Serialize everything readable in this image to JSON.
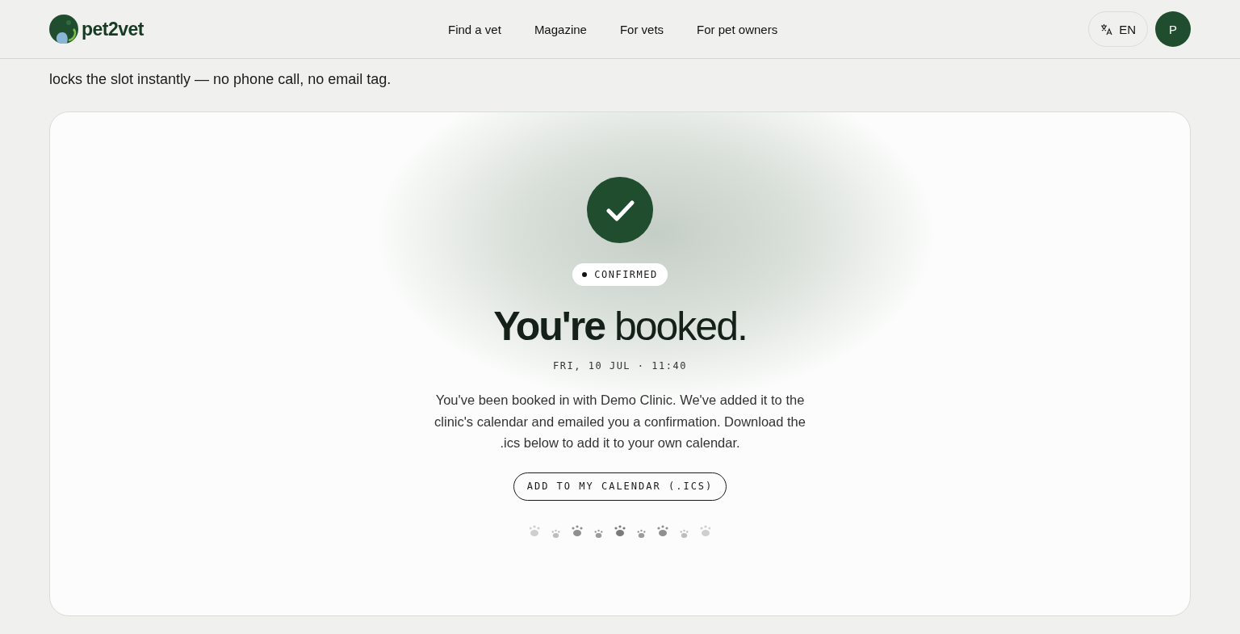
{
  "header": {
    "logo_text": "pet2vet",
    "nav": [
      {
        "label": "Find a vet"
      },
      {
        "label": "Magazine"
      },
      {
        "label": "For vets"
      },
      {
        "label": "For pet owners"
      }
    ],
    "language": "EN",
    "avatar_initial": "P"
  },
  "page": {
    "intro": "locks the slot instantly — no phone call, no email tag."
  },
  "confirmation": {
    "status": "CONFIRMED",
    "heading_bold": "You're",
    "heading_light": "booked.",
    "datetime": "FRI, 10 JUL · 11:40",
    "message": "You've been booked in with Demo Clinic. We've added it to the clinic's calendar and emailed you a confirmation. Download the .ics below to add it to your own calendar.",
    "button": "ADD TO MY CALENDAR (.ICS)"
  }
}
